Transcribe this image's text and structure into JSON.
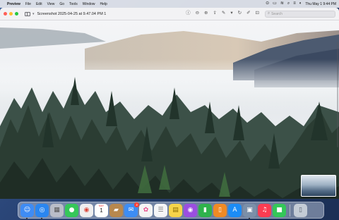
{
  "menubar": {
    "apple_icon": "apple-icon",
    "app_name": "Preview",
    "menus": [
      "File",
      "Edit",
      "View",
      "Go",
      "Tools",
      "Window",
      "Help"
    ],
    "clock": "Thu May 1  9:44 PM"
  },
  "window": {
    "title": "Screenshot 2025-04-25 at 9.47.04 PM 1",
    "search_placeholder": "Search"
  },
  "dock": {
    "apps": [
      {
        "name": "finder",
        "glyph": "☺",
        "color": "#3f8cf4"
      },
      {
        "name": "safari",
        "glyph": "◎",
        "color": "#2a86f0"
      },
      {
        "name": "launchpad",
        "glyph": "▦",
        "color": "#c9c9d2"
      },
      {
        "name": "messages",
        "glyph": "●",
        "color": "#35c759"
      },
      {
        "name": "chrome",
        "glyph": "◉",
        "color": "#e9e9ec"
      },
      {
        "name": "calendar",
        "glyph": "",
        "color": "#ffffff"
      },
      {
        "name": "keynote",
        "glyph": "▰",
        "color": "#b8884e"
      },
      {
        "name": "mail",
        "glyph": "✉",
        "color": "#3d8df5"
      },
      {
        "name": "photos",
        "glyph": "✿",
        "color": "#f2f2f2"
      },
      {
        "name": "reminders",
        "glyph": "☰",
        "color": "#f5f5f7"
      },
      {
        "name": "notes",
        "glyph": "▤",
        "color": "#f6d44a"
      },
      {
        "name": "podcasts",
        "glyph": "◉",
        "color": "#9b4ee0"
      },
      {
        "name": "numbers",
        "glyph": "▮",
        "color": "#2fb24c"
      },
      {
        "name": "books",
        "glyph": "▯",
        "color": "#f08a24"
      },
      {
        "name": "app-store",
        "glyph": "A",
        "color": "#1b8cf6"
      },
      {
        "name": "preview",
        "glyph": "▣",
        "color": "#7b8fa8"
      },
      {
        "name": "music",
        "glyph": "♫",
        "color": "#fb3c52"
      },
      {
        "name": "facetime",
        "glyph": "■",
        "color": "#34c759"
      },
      {
        "name": "trash",
        "glyph": "▯",
        "color": "#c4ccd6"
      }
    ],
    "mail_badge": "3",
    "calendar_month": "MAY",
    "calendar_day": "1"
  }
}
